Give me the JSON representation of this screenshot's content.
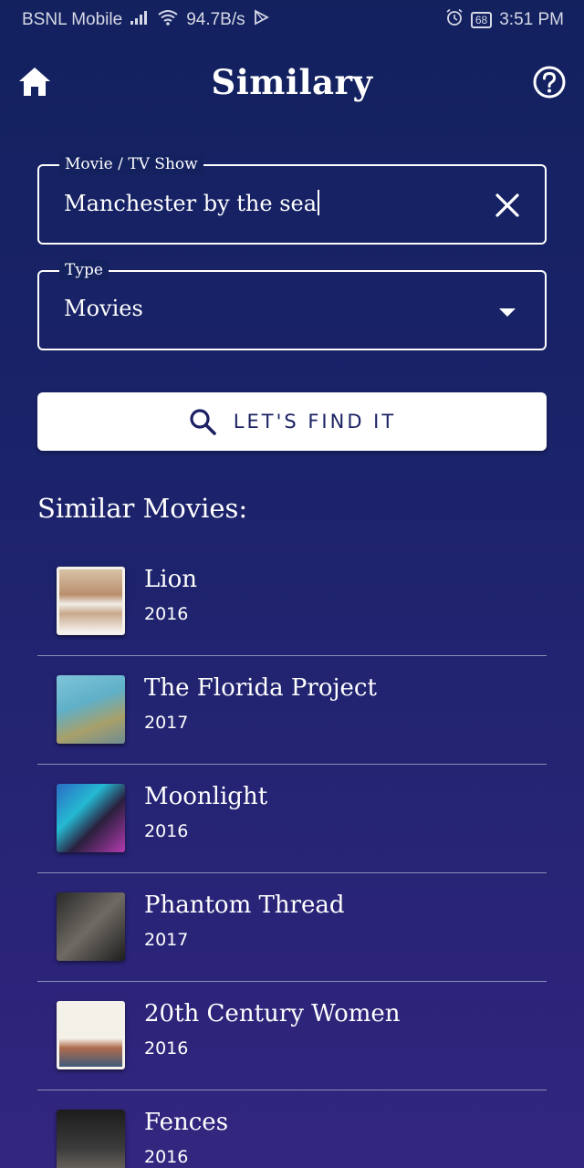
{
  "status_bar": {
    "carrier": "BSNL Mobile",
    "speed": "94.7B/s",
    "battery": "68",
    "time": "3:51 PM"
  },
  "app_bar": {
    "title": "Similary",
    "home_icon": "home-icon",
    "help_icon": "help-circle-icon"
  },
  "search": {
    "label": "Movie / TV Show",
    "value": "Manchester by the sea",
    "clear_icon": "close-icon"
  },
  "type_select": {
    "label": "Type",
    "selected": "Movies",
    "arrow_icon": "dropdown-arrow-icon"
  },
  "find_button": {
    "label": "LET'S FIND IT",
    "icon": "search-icon"
  },
  "results": {
    "heading": "Similar Movies:",
    "items": [
      {
        "title": "Lion",
        "year": "2016"
      },
      {
        "title": "The Florida Project",
        "year": "2017"
      },
      {
        "title": "Moonlight",
        "year": "2016"
      },
      {
        "title": "Phantom Thread",
        "year": "2017"
      },
      {
        "title": "20th Century Women",
        "year": "2016"
      },
      {
        "title": "Fences",
        "year": "2016"
      }
    ]
  },
  "colors": {
    "background_top": "#13215f",
    "background_bottom": "#33267f",
    "button_text": "#1b2163"
  }
}
